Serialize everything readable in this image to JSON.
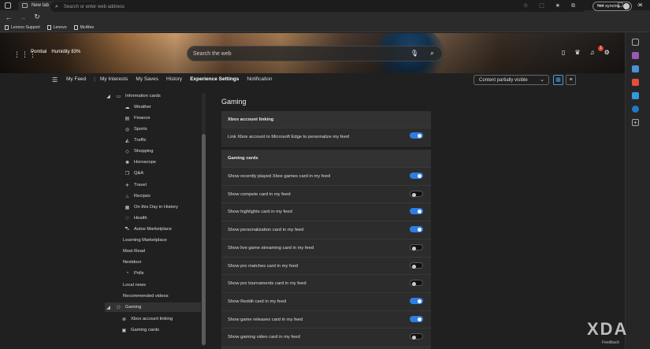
{
  "window": {
    "tab_title": "New tab",
    "new_tab_glyph": "+",
    "min": "—",
    "max": "☐",
    "close": "✕"
  },
  "toolbar": {
    "back": "←",
    "forward": "→",
    "refresh": "↻",
    "home": "⌂",
    "address_placeholder": "Search or enter web address",
    "sync_label": "Not syncing",
    "more": "⋯"
  },
  "bookmarks": [
    "Lenovo Support",
    "Lenovo",
    "McAfee"
  ],
  "hero": {
    "apps_glyph": "⋮⋮⋮",
    "location": "Pombal",
    "humidity": "Humidity 83%",
    "search_placeholder": "Search the web",
    "notif_count": "1"
  },
  "nav": {
    "links": [
      "My Feed",
      "My Interests",
      "My Saves",
      "History",
      "Experience Settings",
      "Notification"
    ],
    "active": "Experience Settings",
    "content_dropdown": "Content partially visible"
  },
  "tree": {
    "items": [
      {
        "label": "Information cards",
        "icon": "info-cards-icon",
        "glyph": "▭"
      },
      {
        "label": "Weather",
        "icon": "weather-icon",
        "glyph": "☁"
      },
      {
        "label": "Finance",
        "icon": "finance-icon",
        "glyph": "▤"
      },
      {
        "label": "Sports",
        "icon": "sports-icon",
        "glyph": "◎"
      },
      {
        "label": "Traffic",
        "icon": "traffic-icon",
        "glyph": "◭"
      },
      {
        "label": "Shopping",
        "icon": "shopping-icon",
        "glyph": "◇"
      },
      {
        "label": "Horoscope",
        "icon": "horoscope-icon",
        "glyph": "✺"
      },
      {
        "label": "Q&A",
        "icon": "qa-icon",
        "glyph": "❐"
      },
      {
        "label": "Travel",
        "icon": "travel-icon",
        "glyph": "✈"
      },
      {
        "label": "Recipes",
        "icon": "recipes-icon",
        "glyph": "♨"
      },
      {
        "label": "On this Day in History",
        "icon": "calendar-icon",
        "glyph": "▦"
      },
      {
        "label": "Health",
        "icon": "health-icon",
        "glyph": "♡"
      },
      {
        "label": "Autos Marketplace",
        "icon": "autos-icon",
        "glyph": "⛍"
      },
      {
        "label": "Learning Marketplace",
        "icon": "",
        "glyph": ""
      },
      {
        "label": "Most Read",
        "icon": "",
        "glyph": ""
      },
      {
        "label": "Nextdoor",
        "icon": "",
        "glyph": ""
      },
      {
        "label": "Polls",
        "icon": "polls-icon",
        "glyph": "◔"
      },
      {
        "label": "Local news",
        "icon": "",
        "glyph": ""
      },
      {
        "label": "Recommended videos",
        "icon": "",
        "glyph": ""
      },
      {
        "label": "Gaming",
        "icon": "gaming-icon",
        "glyph": "◢ ⚇"
      },
      {
        "label": "Xbox account linking",
        "icon": "xbox-icon",
        "glyph": "⊗"
      },
      {
        "label": "Gaming cards",
        "icon": "gaming-cards-icon",
        "glyph": "▣"
      }
    ]
  },
  "main": {
    "heading": "Gaming",
    "xbox_section": {
      "title": "Xbox account linking",
      "row": {
        "label": "Link Xbox account to Microsoft Edge to personalize my feed",
        "on": true
      }
    },
    "cards_section": {
      "title": "Gaming cards",
      "rows": [
        {
          "label": "Show recently played Xbox games card in my feed",
          "on": true
        },
        {
          "label": "Show compete card in my feed",
          "on": false
        },
        {
          "label": "Show highlights card in my feed",
          "on": true
        },
        {
          "label": "Show personalization card in my feed",
          "on": true
        },
        {
          "label": "Show live game streaming card in my feed",
          "on": false
        },
        {
          "label": "Show pro matches card in my feed",
          "on": false
        },
        {
          "label": "Show pro tournaments card in my feed",
          "on": false
        },
        {
          "label": "Show Reddit card in my feed",
          "on": true
        },
        {
          "label": "Show game releases card in my feed",
          "on": true
        },
        {
          "label": "Show gaming video card in my feed",
          "on": false
        }
      ]
    }
  },
  "watermark": "XDA",
  "feedback": "Feedback",
  "colors": {
    "accent": "#2e7de0",
    "toggle_off": "#111111"
  }
}
